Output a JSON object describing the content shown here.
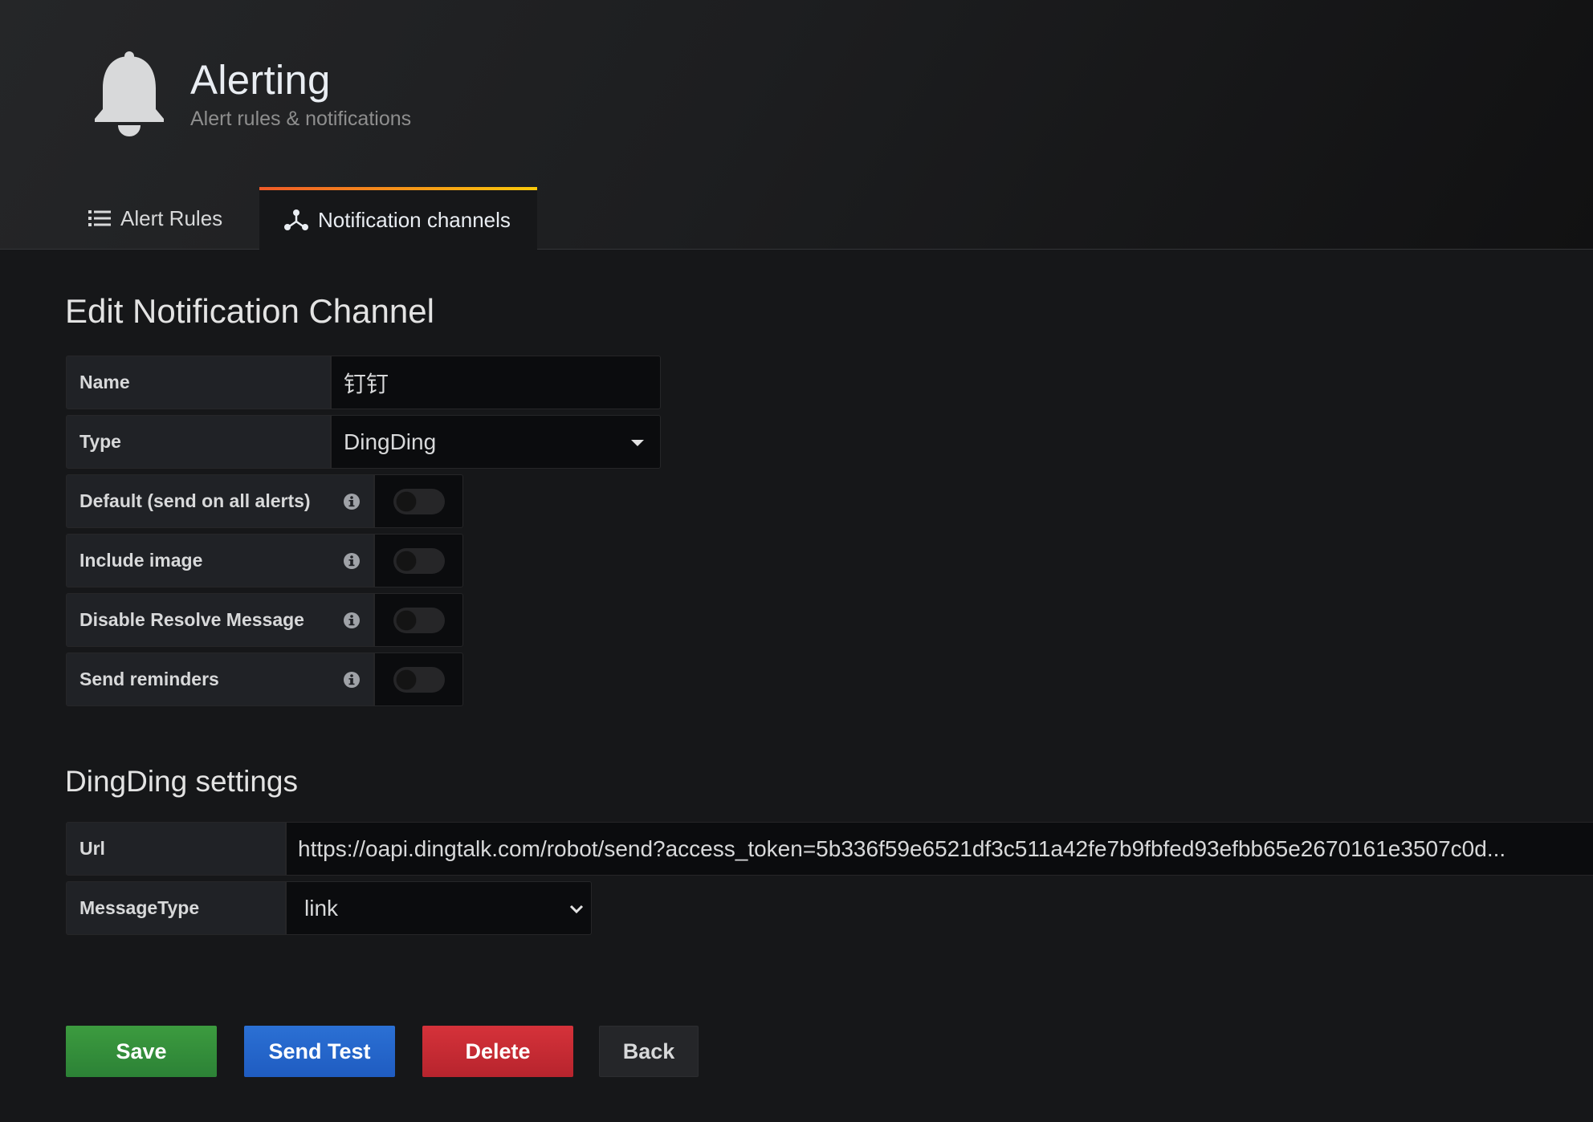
{
  "header": {
    "title": "Alerting",
    "subtitle": "Alert rules & notifications",
    "icon": "bell-icon"
  },
  "tabs": [
    {
      "label": "Alert Rules",
      "icon": "list-icon",
      "active": false
    },
    {
      "label": "Notification channels",
      "icon": "share-nodes-icon",
      "active": true
    }
  ],
  "form": {
    "heading": "Edit Notification Channel",
    "name": {
      "label": "Name",
      "value": "钉钉"
    },
    "type": {
      "label": "Type",
      "value": "DingDing"
    },
    "toggles": [
      {
        "label": "Default (send on all alerts)",
        "checked": false
      },
      {
        "label": "Include image",
        "checked": false
      },
      {
        "label": "Disable Resolve Message",
        "checked": false
      },
      {
        "label": "Send reminders",
        "checked": false
      }
    ]
  },
  "dingding": {
    "heading": "DingDing settings",
    "url": {
      "label": "Url",
      "value": "https://oapi.dingtalk.com/robot/send?access_token=5b336f59e6521df3c511a42fe7b9fbfed93efbb65e2670161e3507c0d..."
    },
    "message_type": {
      "label": "MessageType",
      "value": "link"
    }
  },
  "buttons": {
    "save": "Save",
    "send_test": "Send Test",
    "delete": "Delete",
    "back": "Back"
  },
  "colors": {
    "save": "#2c8236",
    "send_test": "#1f5cc1",
    "delete": "#b7242d",
    "tab_accent_start": "#f05a28",
    "tab_accent_end": "#fbca0a"
  }
}
